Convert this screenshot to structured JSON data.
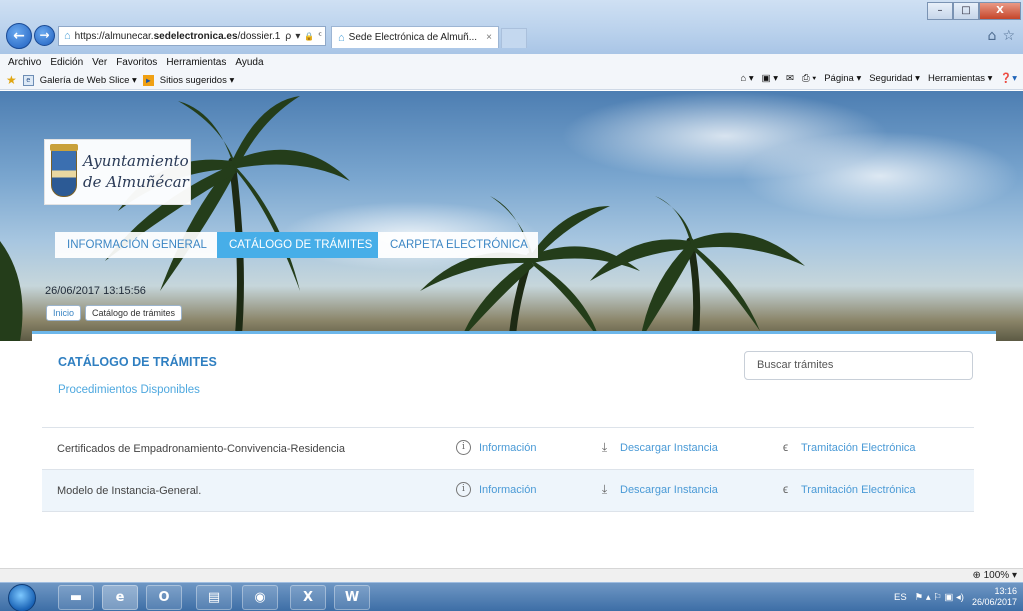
{
  "browser": {
    "url_prefix": "https://almunecar.",
    "url_domain": "sedelectronica.es",
    "url_path": "/dossier.1",
    "tab_title": "Sede Electrónica de Almuñ...",
    "tab_close": "×",
    "search_glyph": "ρ",
    "lock_glyph": "🔒",
    "refresh_glyph": "ᶜ",
    "window_controls": {
      "minimize": "–",
      "maximize": "□",
      "close": "X"
    },
    "menu": [
      "Archivo",
      "Edición",
      "Ver",
      "Favoritos",
      "Herramientas",
      "Ayuda"
    ],
    "favorites": {
      "slice": "Galería de Web Slice ▾",
      "suggested": "Sitios sugeridos ▾"
    },
    "command_bar": [
      "Página ▾",
      "Seguridad ▾",
      "Herramientas ▾"
    ]
  },
  "site": {
    "logo_line1": "Ayuntamiento",
    "logo_line2": "de Almuñécar",
    "nav": [
      "INFORMACIÓN GENERAL",
      "CATÁLOGO DE TRÁMITES",
      "CARPETA ELECTRÓNICA"
    ],
    "active_nav": "CATÁLOGO DE TRÁMITES",
    "datetime": "26/06/2017 13:15:56",
    "breadcrumbs": [
      "Inicio",
      "Catálogo de trámites"
    ]
  },
  "catalog": {
    "title": "CATÁLOGO DE TRÁMITES",
    "subtitle": "Procedimientos Disponibles",
    "search_placeholder": "Buscar trámites",
    "procedures": [
      {
        "name": "Certificados de Empadronamiento-Convivencia-Residencia",
        "info": "Información",
        "download": "Descargar Instancia",
        "electronic": "Tramitación Electrónica"
      },
      {
        "name": "Modelo de Instancia-General.",
        "info": "Información",
        "download": "Descargar Instancia",
        "electronic": "Tramitación Electrónica"
      }
    ]
  },
  "status": {
    "zoom": "100%"
  },
  "taskbar": {
    "language": "ES",
    "time": "13:16",
    "date": "26/06/2017"
  },
  "colors": {
    "accent": "#47aee8",
    "title_blue": "#2f7fc1",
    "link_blue": "#4a9ad6"
  }
}
